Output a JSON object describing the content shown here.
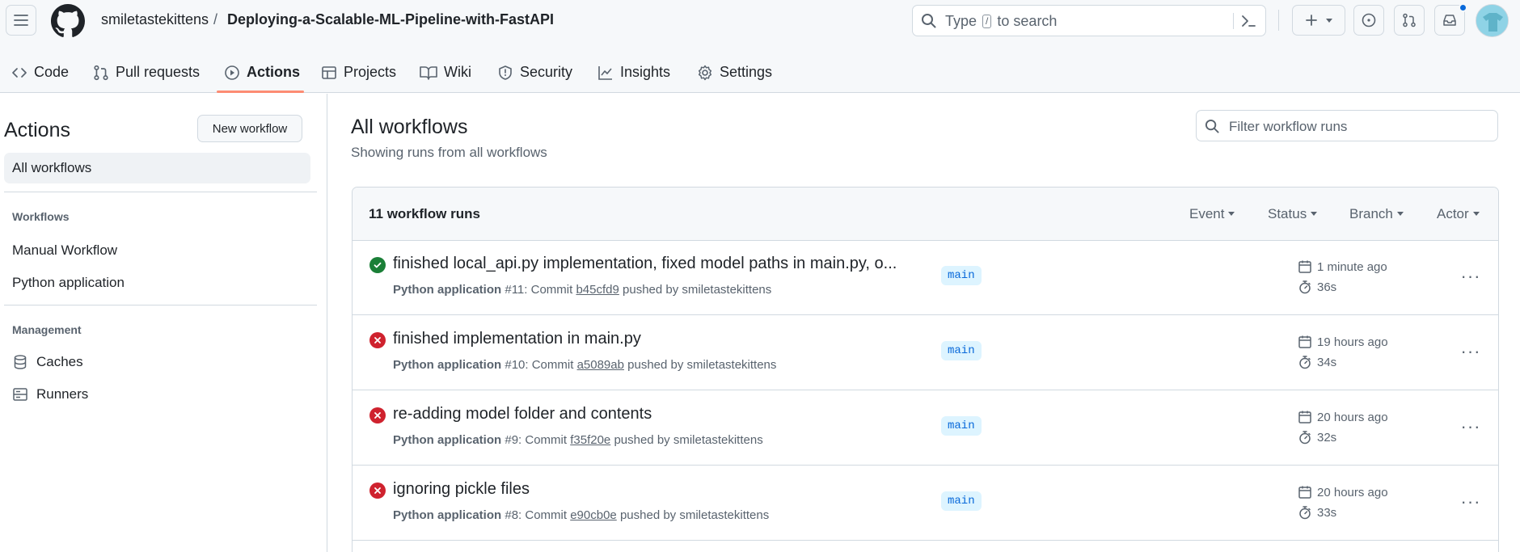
{
  "header": {
    "owner": "smiletastekittens",
    "separator": "/",
    "repo": "Deploying-a-Scalable-ML-Pipeline-with-FastAPI",
    "search_prefix": "Type",
    "search_key": "/",
    "search_suffix": "to search"
  },
  "nav": {
    "code": "Code",
    "pulls": "Pull requests",
    "actions": "Actions",
    "projects": "Projects",
    "wiki": "Wiki",
    "security": "Security",
    "insights": "Insights",
    "settings": "Settings"
  },
  "sidebar": {
    "title": "Actions",
    "new_workflow": "New workflow",
    "all_workflows": "All workflows",
    "workflows_label": "Workflows",
    "workflows": [
      "Manual Workflow",
      "Python application"
    ],
    "management_label": "Management",
    "management": [
      "Caches",
      "Runners"
    ]
  },
  "main": {
    "title": "All workflows",
    "subtitle": "Showing runs from all workflows",
    "filter_placeholder": "Filter workflow runs",
    "runs_count": "11 workflow runs",
    "filters": [
      "Event",
      "Status",
      "Branch",
      "Actor"
    ]
  },
  "runs": [
    {
      "status": "success",
      "title": "finished local_api.py implementation, fixed model paths in main.py, o...",
      "workflow": "Python application",
      "meta_mid": "#11: Commit",
      "sha": "b45cfd9",
      "meta_end": "pushed by smiletastekittens",
      "branch": "main",
      "time": "1 minute ago",
      "duration": "36s"
    },
    {
      "status": "failure",
      "title": "finished implementation in main.py",
      "workflow": "Python application",
      "meta_mid": "#10: Commit",
      "sha": "a5089ab",
      "meta_end": "pushed by smiletastekittens",
      "branch": "main",
      "time": "19 hours ago",
      "duration": "34s"
    },
    {
      "status": "failure",
      "title": "re-adding model folder and contents",
      "workflow": "Python application",
      "meta_mid": "#9: Commit",
      "sha": "f35f20e",
      "meta_end": "pushed by smiletastekittens",
      "branch": "main",
      "time": "20 hours ago",
      "duration": "32s"
    },
    {
      "status": "failure",
      "title": "ignoring pickle files",
      "workflow": "Python application",
      "meta_mid": "#8: Commit",
      "sha": "e90cb0e",
      "meta_end": "pushed by smiletastekittens",
      "branch": "main",
      "time": "20 hours ago",
      "duration": "33s"
    }
  ],
  "colors": {
    "success": "#1a7f37",
    "failure": "#cf222e",
    "accent_underline": "#fd8c73",
    "branch_bg": "#ddf4ff"
  }
}
